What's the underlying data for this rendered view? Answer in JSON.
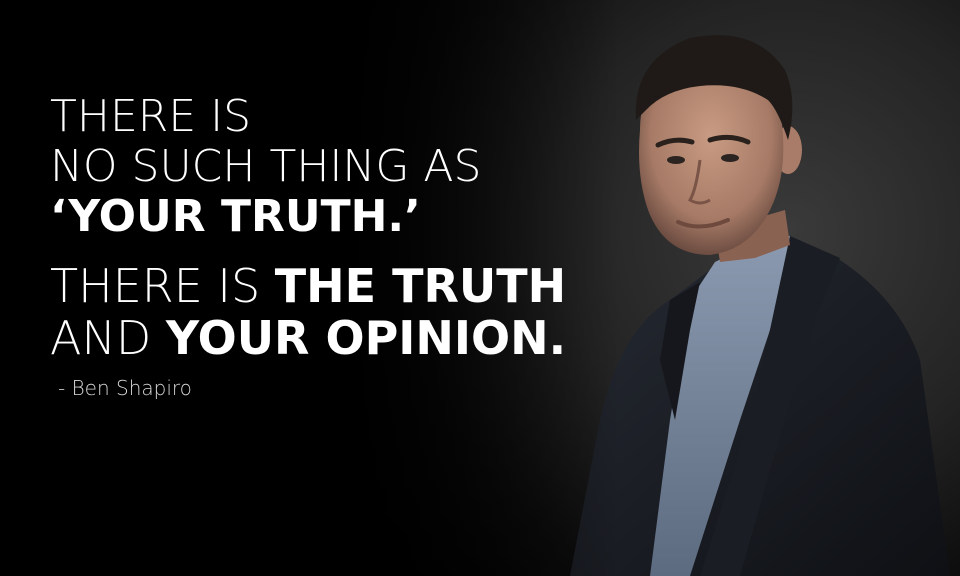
{
  "quote": {
    "line1": "THERE IS",
    "line2": "NO SUCH THING AS",
    "line3": "‘YOUR TRUTH.’",
    "line4_thin": "THERE IS ",
    "line4_bold": "THE TRUTH",
    "line5_thin": "AND ",
    "line5_bold": "YOUR OPINION."
  },
  "attribution": "- Ben Shapiro",
  "colors": {
    "background": "#000000",
    "text": "#ffffff",
    "suit": "#1b1e26",
    "shirt": "#7e8ea3"
  }
}
